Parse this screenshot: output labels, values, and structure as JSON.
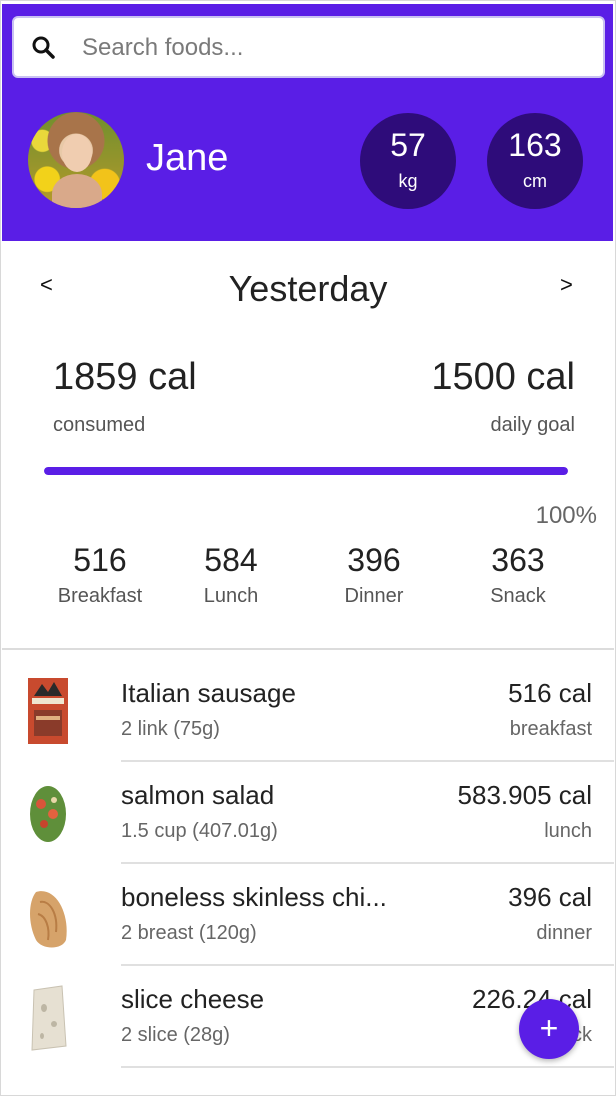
{
  "search": {
    "placeholder": "Search foods..."
  },
  "user": {
    "name": "Jane"
  },
  "stats": [
    {
      "value": "57",
      "unit": "kg"
    },
    {
      "value": "163",
      "unit": "cm"
    }
  ],
  "day": {
    "title": "Yesterday",
    "prev": "<",
    "next": ">"
  },
  "summary": {
    "consumed": "1859 cal",
    "consumed_label": "consumed",
    "goal": "1500 cal",
    "goal_label": "daily goal",
    "percent": "100%",
    "progress_fraction": 1.0
  },
  "meals": [
    {
      "value": "516",
      "label": "Breakfast"
    },
    {
      "value": "584",
      "label": "Lunch"
    },
    {
      "value": "396",
      "label": "Dinner"
    },
    {
      "value": "363",
      "label": "Snack"
    }
  ],
  "foods": [
    {
      "name": "Italian sausage",
      "amount": "2 link (75g)",
      "cal": "516 cal",
      "meal": "breakfast"
    },
    {
      "name": "salmon salad",
      "amount": "1.5 cup (407.01g)",
      "cal": "583.905 cal",
      "meal": "lunch"
    },
    {
      "name": "boneless skinless chi...",
      "amount": "2 breast (120g)",
      "cal": "396 cal",
      "meal": "dinner"
    },
    {
      "name": "slice cheese",
      "amount": "2 slice (28g)",
      "cal": "226.24 cal",
      "meal": "snack"
    }
  ],
  "fab": {
    "label": "+"
  },
  "colors": {
    "accent": "#5a1ee6",
    "stat_bg": "#2e0c7a"
  }
}
